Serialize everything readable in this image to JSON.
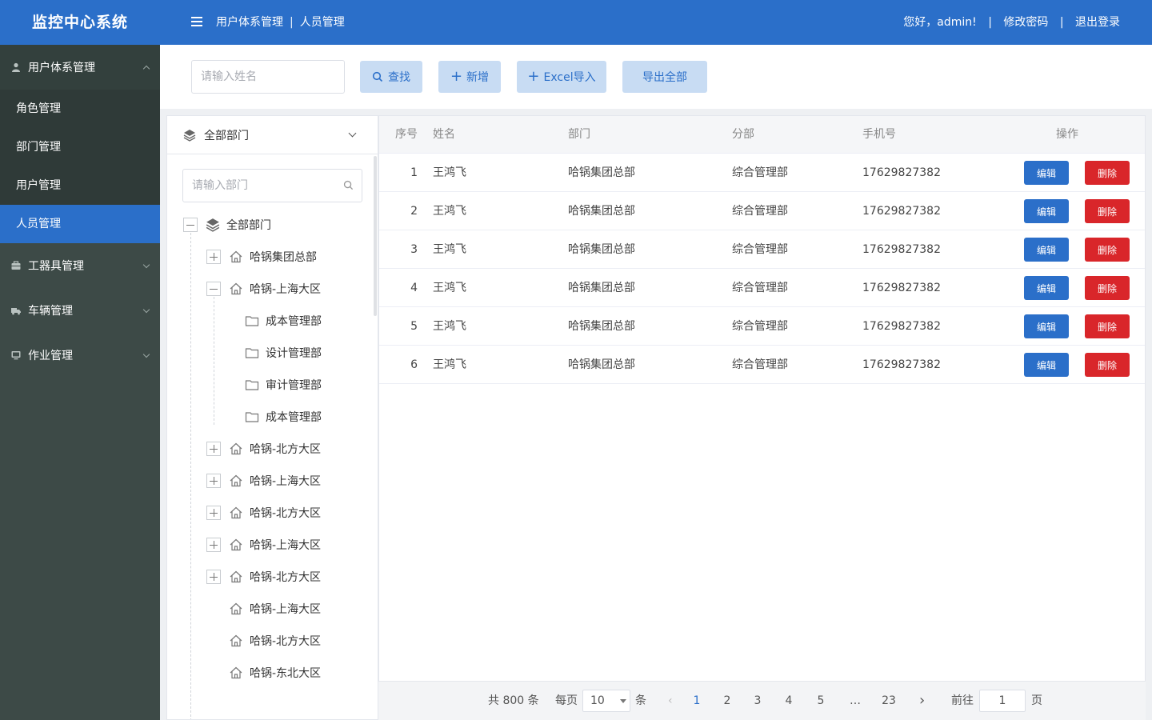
{
  "header": {
    "logo": "监控中心系统",
    "breadcrumb": [
      "用户体系管理",
      "人员管理"
    ],
    "greeting": "您好，admin!",
    "change_password": "修改密码",
    "logout": "退出登录",
    "accent_color": "#2b6fc9"
  },
  "sidebar": {
    "groups": [
      {
        "label": "用户体系管理",
        "icon": "user-icon",
        "expanded": true
      },
      {
        "label": "工器具管理",
        "icon": "toolbox-icon",
        "expanded": false
      },
      {
        "label": "车辆管理",
        "icon": "truck-icon",
        "expanded": false
      },
      {
        "label": "作业管理",
        "icon": "monitor-icon",
        "expanded": false
      }
    ],
    "items": [
      {
        "label": "角色管理"
      },
      {
        "label": "部门管理"
      },
      {
        "label": "用户管理"
      },
      {
        "label": "人员管理",
        "active": true
      }
    ]
  },
  "toolbar": {
    "name_placeholder": "请输入姓名",
    "search_label": "查找",
    "add_label": "新增",
    "import_label": "Excel导入",
    "export_label": "导出全部"
  },
  "tree": {
    "header_label": "全部部门",
    "search_placeholder": "请输入部门",
    "root": "全部部门",
    "nodes": [
      {
        "label": "哈锅集团总部"
      },
      {
        "label": "哈锅-上海大区"
      },
      {
        "label": "成本管理部"
      },
      {
        "label": "设计管理部"
      },
      {
        "label": "审计管理部"
      },
      {
        "label": "成本管理部"
      },
      {
        "label": "哈锅-北方大区"
      },
      {
        "label": "哈锅-上海大区"
      },
      {
        "label": "哈锅-北方大区"
      },
      {
        "label": "哈锅-上海大区"
      },
      {
        "label": "哈锅-北方大区"
      },
      {
        "label": "哈锅-上海大区"
      },
      {
        "label": "哈锅-北方大区"
      },
      {
        "label": "哈锅-东北大区"
      }
    ]
  },
  "table": {
    "columns": [
      "序号",
      "姓名",
      "部门",
      "分部",
      "手机号",
      "操作"
    ],
    "edit_label": "编辑",
    "delete_label": "删除",
    "rows": [
      {
        "no": "1",
        "name": "王鸿飞",
        "dept": "哈锅集团总部",
        "sub": "综合管理部",
        "phone": "17629827382"
      },
      {
        "no": "2",
        "name": "王鸿飞",
        "dept": "哈锅集团总部",
        "sub": "综合管理部",
        "phone": "17629827382"
      },
      {
        "no": "3",
        "name": "王鸿飞",
        "dept": "哈锅集团总部",
        "sub": "综合管理部",
        "phone": "17629827382"
      },
      {
        "no": "4",
        "name": "王鸿飞",
        "dept": "哈锅集团总部",
        "sub": "综合管理部",
        "phone": "17629827382"
      },
      {
        "no": "5",
        "name": "王鸿飞",
        "dept": "哈锅集团总部",
        "sub": "综合管理部",
        "phone": "17629827382"
      },
      {
        "no": "6",
        "name": "王鸿飞",
        "dept": "哈锅集团总部",
        "sub": "综合管理部",
        "phone": "17629827382"
      }
    ]
  },
  "pagination": {
    "total": "共 800 条",
    "per_page_prefix": "每页",
    "per_page_value": "10",
    "per_page_suffix": "条",
    "pages": [
      "1",
      "2",
      "3",
      "4",
      "5",
      "…",
      "23"
    ],
    "current": "1",
    "goto_prefix": "前往",
    "goto_value": "1",
    "goto_suffix": "页"
  }
}
